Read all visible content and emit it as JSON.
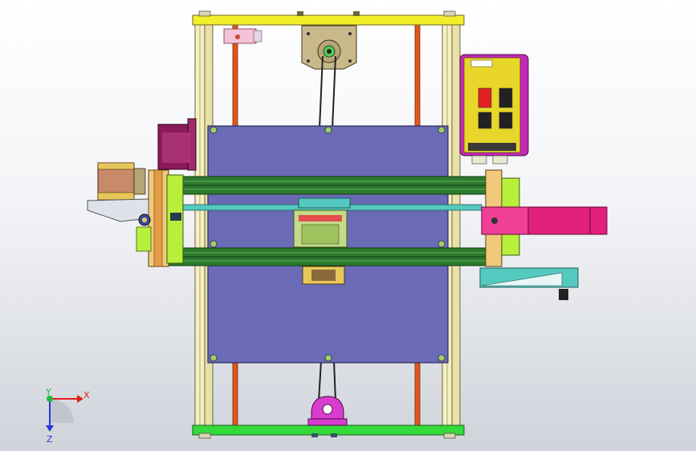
{
  "viewport": {
    "background_top": "#ffffff",
    "background_bottom": "#cfd3da"
  },
  "triad": {
    "x_label": "X",
    "y_label": "Y",
    "z_label": "Z",
    "x_color": "#e0201a",
    "y_color": "#1fb83a",
    "z_color": "#2438d8"
  },
  "colors": {
    "frame_yellow": "#f2ee2a",
    "frame_green": "#34d93a",
    "bed_purple": "#6a6ab6",
    "rail_green": "#2d7a2d",
    "rod_orange": "#e0571c",
    "motor_magenta": "#e0207a",
    "board_yellow": "#e8d62a",
    "board_magenta": "#c42ab8",
    "extrusion_cream": "#f5efc2",
    "teal_part": "#54c9c0",
    "pulley_tan": "#c9b98a",
    "lime_part": "#b7ef3a",
    "dark_motor": "#8a1a5a"
  }
}
